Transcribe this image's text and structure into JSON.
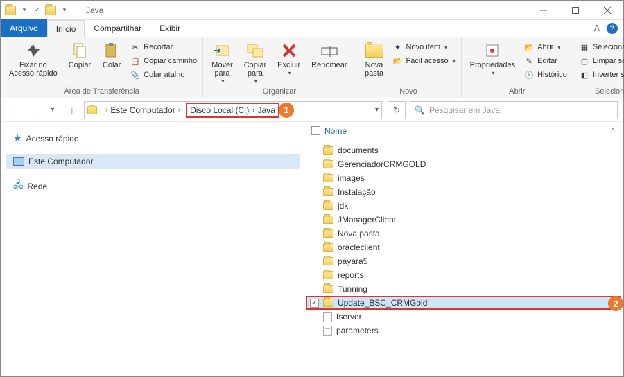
{
  "titlebar": {
    "app_title": "Java"
  },
  "tabs": {
    "file": "Arquivo",
    "home": "Início",
    "share": "Compartilhar",
    "view": "Exibir"
  },
  "ribbon": {
    "clipboard": {
      "label": "Área de Transferência",
      "pin": "Fixar no\nAcesso rápido",
      "copy": "Copiar",
      "paste": "Colar",
      "cut": "Recortar",
      "copy_path": "Copiar caminho",
      "paste_shortcut": "Colar atalho"
    },
    "organize": {
      "label": "Organizar",
      "move_to": "Mover\npara",
      "copy_to": "Copiar\npara",
      "delete": "Excluir",
      "rename": "Renomear"
    },
    "new_group": {
      "label": "Novo",
      "new_folder": "Nova\npasta",
      "new_item": "Novo item",
      "easy_access": "Fácil acesso"
    },
    "open_group": {
      "label": "Abrir",
      "properties": "Propriedades",
      "open": "Abrir",
      "edit": "Editar",
      "history": "Histórico"
    },
    "select_group": {
      "label": "Selecionar",
      "select_all": "Selecionar tudo",
      "clear_selection": "Limpar seleção",
      "invert_selection": "Inverter seleção"
    }
  },
  "breadcrumb": {
    "root": "Este Computador",
    "drive": "Disco Local (C:)",
    "folder": "Java"
  },
  "search": {
    "placeholder": "Pesquisar em Java"
  },
  "navpane": {
    "quick_access": "Acesso rápido",
    "this_pc": "Este Computador",
    "network": "Rede"
  },
  "list": {
    "column_name": "Nome",
    "items": [
      {
        "name": "documents",
        "type": "folder"
      },
      {
        "name": "GerenciadorCRMGOLD",
        "type": "folder"
      },
      {
        "name": "images",
        "type": "folder"
      },
      {
        "name": "Instalação",
        "type": "folder"
      },
      {
        "name": "jdk",
        "type": "folder"
      },
      {
        "name": "JManagerClient",
        "type": "folder"
      },
      {
        "name": "Nova pasta",
        "type": "folder"
      },
      {
        "name": "oracleclient",
        "type": "folder"
      },
      {
        "name": "payara5",
        "type": "folder"
      },
      {
        "name": "reports",
        "type": "folder"
      },
      {
        "name": "Tunning",
        "type": "folder"
      },
      {
        "name": "Update_BSC_CRMGold",
        "type": "folder",
        "selected": true
      },
      {
        "name": "fserver",
        "type": "file"
      },
      {
        "name": "parameters",
        "type": "file"
      }
    ]
  },
  "callouts": {
    "one": "1",
    "two": "2"
  }
}
